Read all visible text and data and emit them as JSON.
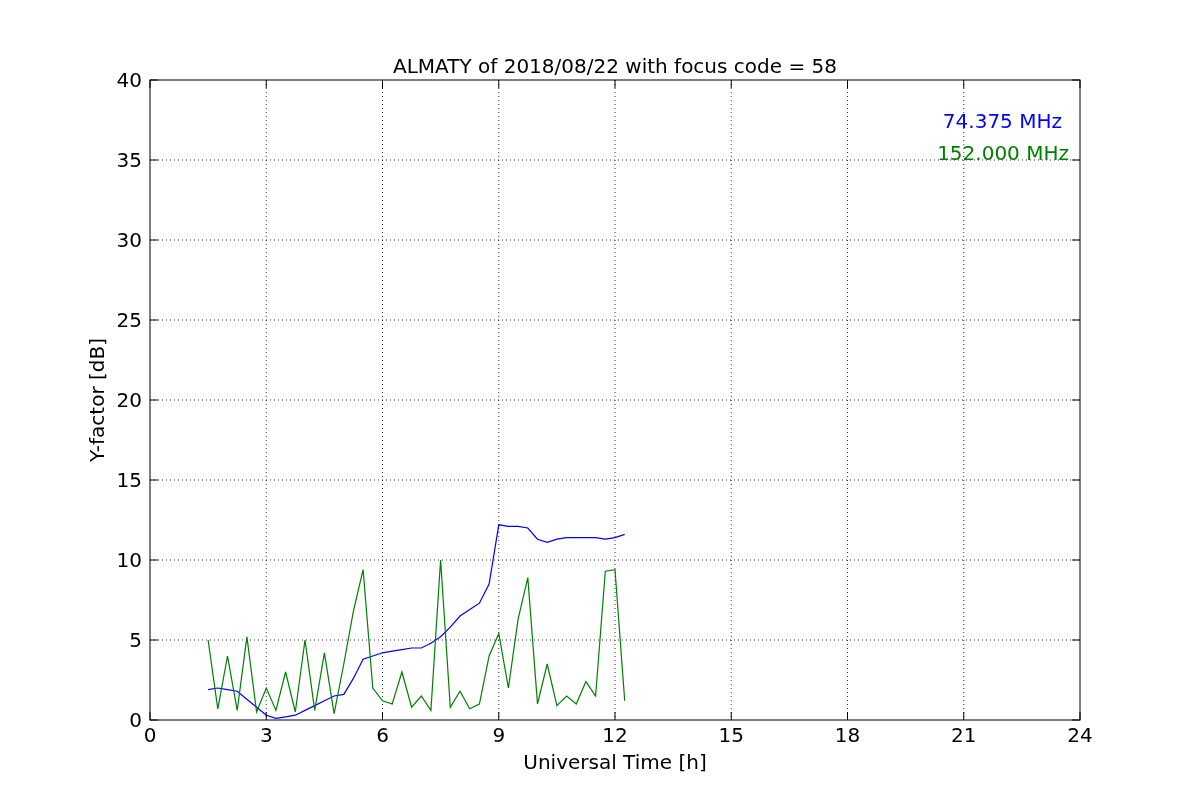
{
  "chart_data": {
    "type": "line",
    "title": "ALMATY of 2018/08/22 with focus code = 58",
    "xlabel": "Universal Time [h]",
    "ylabel": "Y-factor [dB]",
    "xlim": [
      0,
      24
    ],
    "ylim": [
      0,
      40
    ],
    "grid": true,
    "xticks": [
      0,
      3,
      6,
      9,
      12,
      15,
      18,
      21,
      24
    ],
    "yticks": [
      0,
      5,
      10,
      15,
      20,
      25,
      30,
      35,
      40
    ],
    "x": [
      1.5,
      1.75,
      2.0,
      2.25,
      2.5,
      2.75,
      3.0,
      3.25,
      3.5,
      3.75,
      4.0,
      4.25,
      4.5,
      4.75,
      5.0,
      5.25,
      5.5,
      5.75,
      6.0,
      6.25,
      6.5,
      6.75,
      7.0,
      7.25,
      7.5,
      7.75,
      8.0,
      8.25,
      8.5,
      8.75,
      9.0,
      9.25,
      9.5,
      9.75,
      10.0,
      10.25,
      10.5,
      10.75,
      11.0,
      11.25,
      11.5,
      11.75,
      12.0,
      12.25
    ],
    "series": [
      {
        "name": "74.375 MHz",
        "color": "#0000ff",
        "values": [
          1.9,
          2.0,
          1.9,
          1.8,
          1.3,
          0.8,
          0.3,
          0.1,
          0.2,
          0.3,
          0.6,
          0.9,
          1.2,
          1.5,
          1.6,
          2.6,
          3.8,
          4.0,
          4.2,
          4.3,
          4.4,
          4.5,
          4.5,
          4.8,
          5.2,
          5.8,
          6.5,
          6.9,
          7.3,
          8.5,
          12.2,
          12.1,
          12.1,
          12.0,
          11.3,
          11.1,
          11.3,
          11.4,
          11.4,
          11.4,
          11.4,
          11.3,
          11.4,
          11.6
        ]
      },
      {
        "name": "152.000 MHz",
        "color": "#008000",
        "values": [
          5.0,
          0.7,
          4.0,
          0.6,
          5.2,
          0.5,
          2.0,
          0.6,
          3.0,
          0.5,
          5.0,
          0.6,
          4.2,
          0.4,
          3.5,
          6.8,
          9.4,
          2.0,
          1.2,
          1.0,
          3.0,
          0.8,
          1.5,
          0.6,
          10.0,
          0.8,
          1.8,
          0.7,
          1.0,
          4.0,
          5.4,
          2.0,
          6.3,
          8.9,
          1.0,
          3.5,
          0.9,
          1.5,
          1.0,
          2.4,
          1.5,
          9.3,
          9.4,
          1.2
        ]
      }
    ]
  }
}
